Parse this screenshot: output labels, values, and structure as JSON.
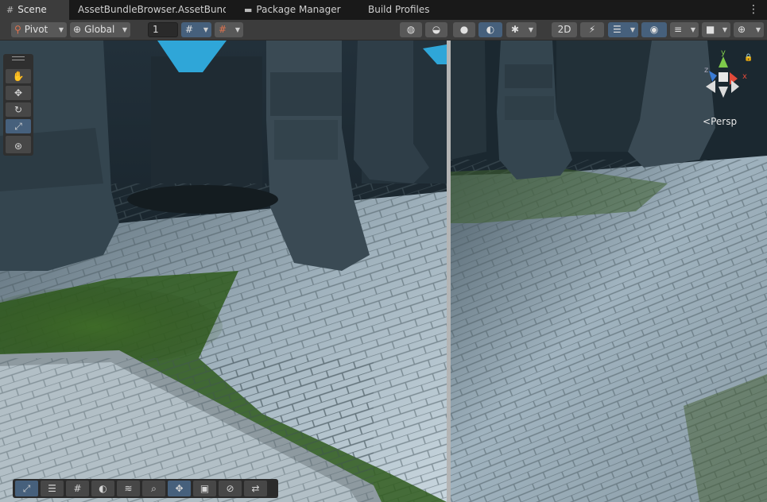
{
  "tabs": [
    {
      "label": "Scene",
      "icon": "scene-grid-icon",
      "active": true
    },
    {
      "label": "AssetBundleBrowser.AssetBundl",
      "icon": "",
      "active": false
    },
    {
      "label": "Package Manager",
      "icon": "package-icon",
      "active": false
    },
    {
      "label": "Build Profiles",
      "icon": "",
      "active": false
    }
  ],
  "toolbar": {
    "pivot_label": "Pivot",
    "global_label": "Global",
    "grid_snap_value": "1"
  },
  "scene": {
    "projection_label": "Persp",
    "gizmo_axes": {
      "y": "y",
      "x": "x",
      "z": "z"
    }
  },
  "colors": {
    "selected_button": "#46607c",
    "toolbar_bg": "#3c3c3c",
    "tabbar_bg": "#191919",
    "gizmo_x": "#e04a3a",
    "gizmo_y": "#7ec94a",
    "gizmo_z": "#3a7bd5"
  }
}
